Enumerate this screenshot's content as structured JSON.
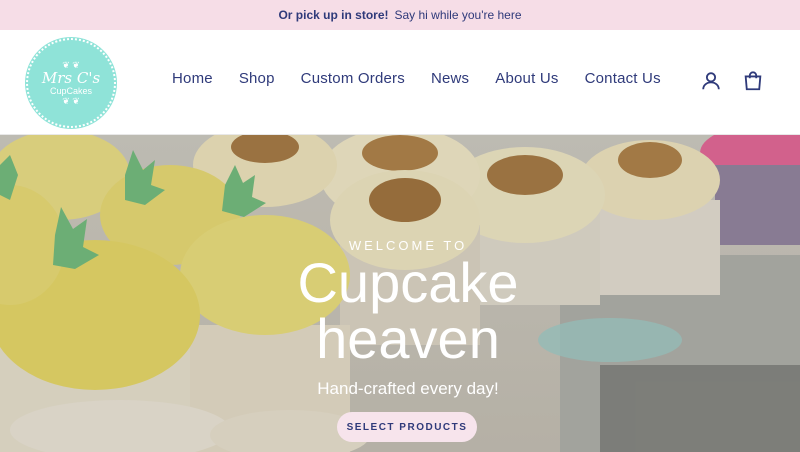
{
  "announcement": {
    "bold_text": "Or pick up in store!",
    "text": "Say hi while you're here"
  },
  "logo": {
    "line1": "Mrs C's",
    "line2": "CupCakes"
  },
  "nav": {
    "items": [
      {
        "label": "Home"
      },
      {
        "label": "Shop"
      },
      {
        "label": "Custom Orders"
      },
      {
        "label": "News"
      },
      {
        "label": "About Us"
      },
      {
        "label": "Contact Us"
      }
    ]
  },
  "icons": {
    "account": "user-icon",
    "cart": "cart-icon"
  },
  "hero": {
    "eyebrow": "WELCOME TO",
    "title_line1": "Cupcake",
    "title_line2": "heaven",
    "tagline": "Hand-crafted every day!",
    "cta_label": "Select products"
  },
  "colors": {
    "brand_navy": "#2f3a7a",
    "announcement_bg": "#f6dde7",
    "logo_mint": "#8fe3d8",
    "cta_bg": "#f7e4ec"
  }
}
